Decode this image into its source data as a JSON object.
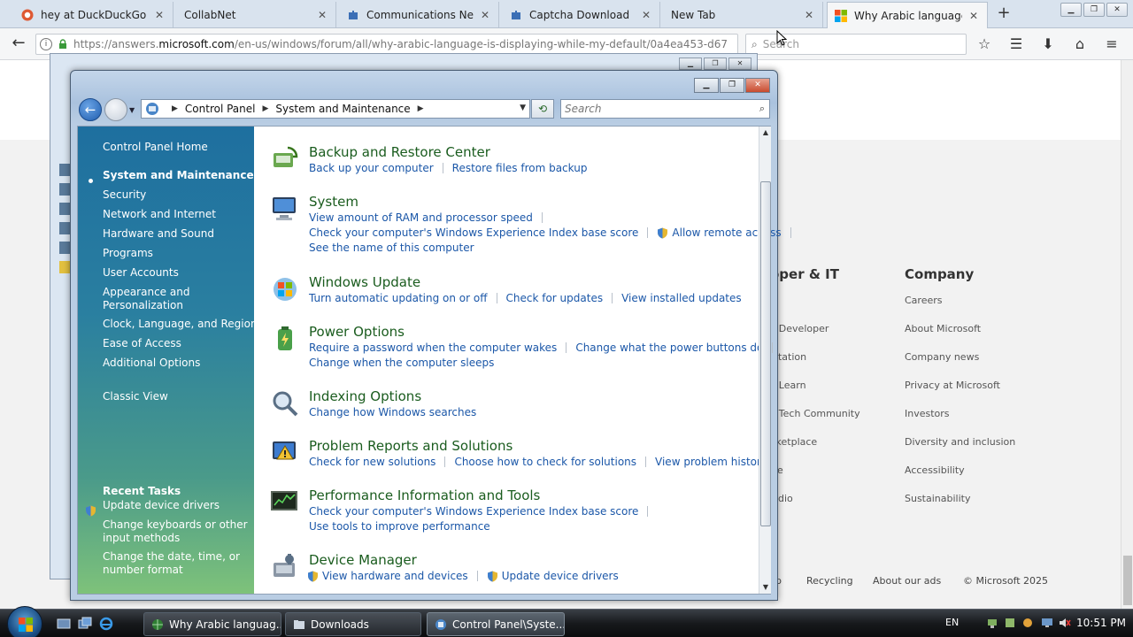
{
  "browser": {
    "tabs": [
      {
        "label": "hey at DuckDuckGo",
        "close": "✕"
      },
      {
        "label": "CollabNet",
        "close": "✕"
      },
      {
        "label": "Communications Netw",
        "close": "✕"
      },
      {
        "label": "Captcha Download",
        "close": "✕"
      },
      {
        "label": "New Tab",
        "close": "✕"
      },
      {
        "label": "Why Arabic language i",
        "close": "✕"
      }
    ],
    "new_tab": "+",
    "url_prefix": "https://answers.",
    "url_host": "microsoft.com",
    "url_path": "/en-us/windows/forum/all/why-arabic-language-is-displaying-while-my-default/0a4ea453-d67",
    "search_placeholder": "Search"
  },
  "webpage": {
    "col1_heading": "oper & IT",
    "col1_links": [
      "t Developer",
      "ntation",
      "t Learn",
      "t Tech Community",
      "rketplace",
      "ce",
      "udio"
    ],
    "col2_heading": "Company",
    "col2_links": [
      "Careers",
      "About Microsoft",
      "Company news",
      "Privacy at Microsoft",
      "Investors",
      "Diversity and inclusion",
      "Accessibility",
      "Sustainability"
    ],
    "footer": [
      "p",
      "Recycling",
      "About our ads",
      "© Microsoft 2025"
    ]
  },
  "control_panel": {
    "address": {
      "root": "Control Panel",
      "current": "System and Maintenance"
    },
    "search_placeholder": "Search",
    "sidebar": {
      "home": "Control Panel Home",
      "items": [
        "System and Maintenance",
        "Security",
        "Network and Internet",
        "Hardware and Sound",
        "Programs",
        "User Accounts",
        "Appearance and",
        "Personalization",
        "Clock, Language, and Region",
        "Ease of Access",
        "Additional Options"
      ],
      "classic": "Classic View",
      "recent_header": "Recent Tasks",
      "recent": [
        "Update device drivers",
        "Change keyboards or other",
        "input methods",
        "Change the date, time, or",
        "number format"
      ]
    },
    "categories": [
      {
        "title": "Backup and Restore Center",
        "lines": [
          [
            "Back up your computer",
            "Restore files from backup"
          ]
        ]
      },
      {
        "title": "System",
        "lines": [
          [
            "View amount of RAM and processor speed"
          ],
          [
            "Check your computer's Windows Experience Index base score",
            "Allow remote access"
          ],
          [
            "See the name of this computer"
          ]
        ]
      },
      {
        "title": "Windows Update",
        "lines": [
          [
            "Turn automatic updating on or off",
            "Check for updates",
            "View installed updates"
          ]
        ]
      },
      {
        "title": "Power Options",
        "lines": [
          [
            "Require a password when the computer wakes",
            "Change what the power buttons do"
          ],
          [
            "Change when the computer sleeps"
          ]
        ]
      },
      {
        "title": "Indexing Options",
        "lines": [
          [
            "Change how Windows searches"
          ]
        ]
      },
      {
        "title": "Problem Reports and Solutions",
        "lines": [
          [
            "Check for new solutions",
            "Choose how to check for solutions",
            "View problem history"
          ]
        ]
      },
      {
        "title": "Performance Information and Tools",
        "lines": [
          [
            "Check your computer's Windows Experience Index base score"
          ],
          [
            "Use tools to improve performance"
          ]
        ]
      },
      {
        "title": "Device Manager",
        "lines": [
          [
            "View hardware and devices",
            "Update device drivers"
          ]
        ]
      }
    ]
  },
  "taskbar": {
    "buttons": [
      "Why Arabic languag...",
      "Downloads",
      "Control Panel\\Syste..."
    ],
    "lang": "EN",
    "clock": "10:51 PM"
  }
}
